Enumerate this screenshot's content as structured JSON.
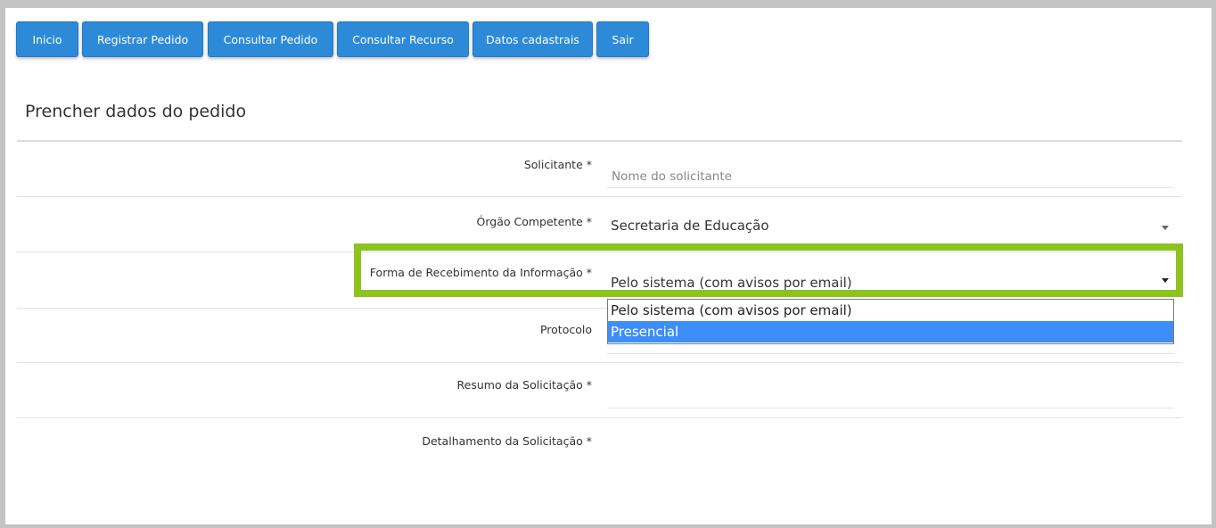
{
  "nav": {
    "items": [
      "Inicio",
      "Registrar Pedido",
      "Consultar Pedido",
      "Consultar Recurso",
      "Datos cadastrais",
      "Sair"
    ]
  },
  "page": {
    "title": "Prencher dados do pedido"
  },
  "form": {
    "solicitante": {
      "label": "Solicitante *",
      "placeholder": "Nome do solicitante"
    },
    "orgao": {
      "label": "Órgão Competente *",
      "value": "Secretaria de Educação"
    },
    "forma": {
      "label": "Forma de Recebimento da Informação *",
      "value": "Pelo sistema (com avisos por email)",
      "options": [
        "Pelo sistema (com avisos por email)",
        "Presencial"
      ],
      "highlighted_option": "Presencial"
    },
    "protocolo": {
      "label": "Protocolo"
    },
    "resumo": {
      "label": "Resumo da Solicitação *"
    },
    "detalhamento": {
      "label": "Detalhamento da Solicitação *"
    }
  },
  "colors": {
    "nav_button": "#2d8ad9",
    "highlight_border": "#8dc21f",
    "option_selected": "#3d8ef7"
  }
}
